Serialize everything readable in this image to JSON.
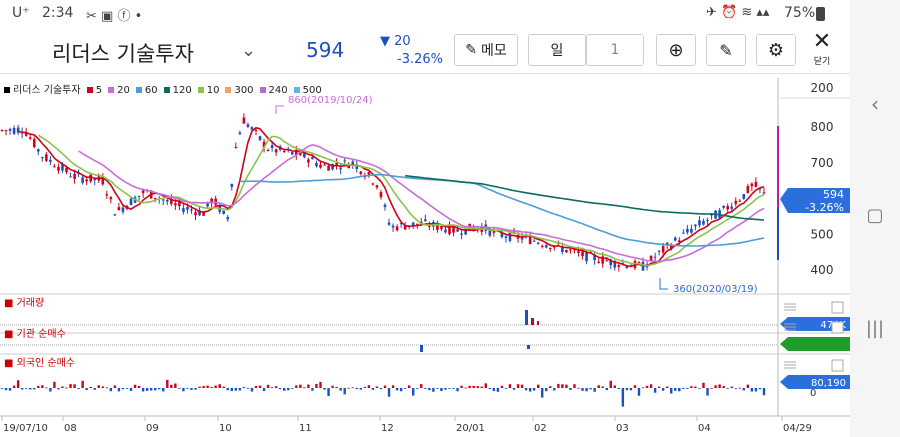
{
  "status": {
    "carrier": "U⁺",
    "time": "2:34",
    "battery": "75%"
  },
  "header": {
    "stock_name": "리더스 기술투자",
    "price": "594",
    "change_amount": "20",
    "change_percent": "-3.26%",
    "memo_label": "메모",
    "period_label": "일",
    "period_count": "1",
    "close_label": "닫기"
  },
  "legend": {
    "name": "리더스 기술투자",
    "items": [
      {
        "label": "5",
        "color": "#d0021b"
      },
      {
        "label": "20",
        "color": "#c86dd7"
      },
      {
        "label": "60",
        "color": "#4a9fd8"
      },
      {
        "label": "120",
        "color": "#0b6b5e"
      },
      {
        "label": "10",
        "color": "#8bc34a"
      },
      {
        "label": "300",
        "color": "#f0a070"
      },
      {
        "label": "240",
        "color": "#b06fd0"
      },
      {
        "label": "500",
        "color": "#5bb5e8"
      }
    ]
  },
  "colors": {
    "up": "#d0021b",
    "down": "#1e4fbf",
    "accent": "#2a6fdb"
  },
  "chart_data": {
    "type": "candlestick",
    "x_labels": [
      "19/07/10",
      "08",
      "09",
      "10",
      "11",
      "12",
      "20/01",
      "02",
      "03",
      "04",
      "04/29"
    ],
    "y_ticks": [
      200,
      400,
      500,
      600,
      700,
      800
    ],
    "annotations": {
      "high": "860(2019/10/24)",
      "low": "360(2020/03/19)"
    },
    "current_badge": {
      "price": "594",
      "change": "-3.26%"
    },
    "panels": [
      {
        "name": "거래량",
        "badge": "470K",
        "badge_color": "#2a6fdb"
      },
      {
        "name": "기관 순매수",
        "badge": "",
        "badge_color": "#1f9d2b"
      },
      {
        "name": "외국인 순매수",
        "badge": "80,190",
        "badge_color": "#2a6fdb",
        "zero_tick": "0"
      }
    ]
  }
}
